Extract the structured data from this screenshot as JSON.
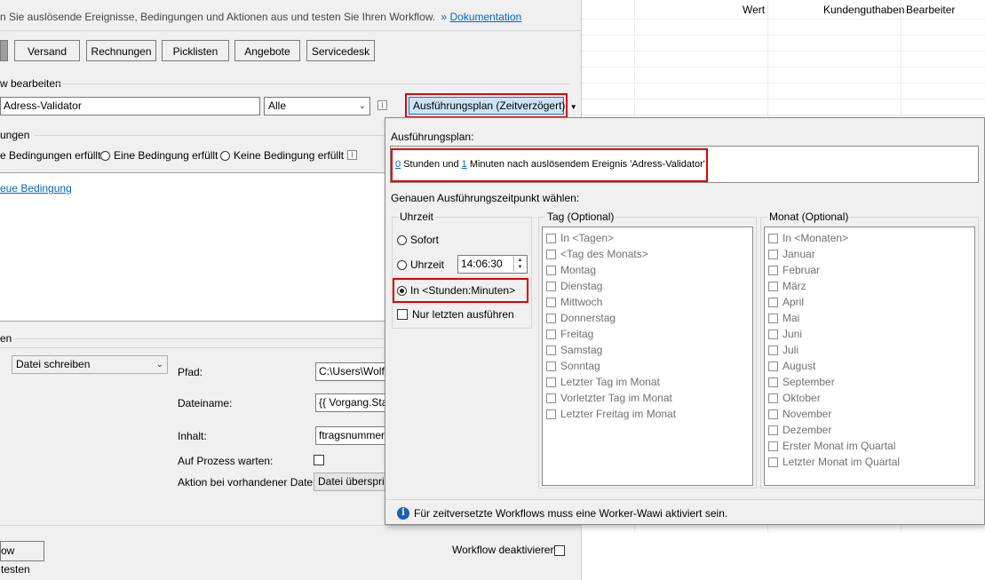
{
  "header": {
    "intro_text": "n Sie auslösende Ereignisse, Bedingungen und Aktionen aus und testen Sie Ihren Workflow.",
    "doc_prefix": "»",
    "doc_link": "Dokumentation"
  },
  "tabs": [
    "Versand",
    "Rechnungen",
    "Picklisten",
    "Angebote",
    "Servicedesk"
  ],
  "workflow": {
    "section_label": "w bearbeiten",
    "name_value": "Adress-Validator",
    "scope_value": "Alle",
    "schedule_button": "Ausführungsplan (Zeitverzögert)"
  },
  "conditions": {
    "section_label": "ungen",
    "radio_all": "e Bedingungen erfüllt",
    "radio_one": "Eine Bedingung erfüllt",
    "radio_none": "Keine Bedingung erfüllt",
    "new_link": "eue Bedingung"
  },
  "actions": {
    "section_label": "en",
    "action_value": "Datei schreiben",
    "path_label": "Pfad:",
    "path_value": "C:\\Users\\Wolf\\",
    "filename_label": "Dateiname:",
    "filename_value": "{{ Vorgang.Star",
    "content_label": "Inhalt:",
    "content_value": "ftragsnummer }}",
    "wait_label": "Auf Prozess warten:",
    "existing_label": "Aktion bei vorhandener Datei:",
    "existing_value": "Datei überspring"
  },
  "footer": {
    "test_button": "ow testen",
    "deactivate_label": "Workflow deaktivieren"
  },
  "grid": {
    "columns": [
      "Wert",
      "Kundenguthaben",
      "Bearbeiter"
    ]
  },
  "popup": {
    "plan_label": "Ausführungsplan:",
    "plan_hours": "0",
    "plan_mid": "Stunden und",
    "plan_minutes": "1",
    "plan_rest": "Minuten nach auslösendem Ereignis 'Adress-Validator'",
    "choose_label": "Genauen Ausführungszeitpunkt wählen:",
    "time_group": "Uhrzeit",
    "opt_sofort": "Sofort",
    "opt_uhrzeit": "Uhrzeit",
    "time_value": "14:06:30",
    "opt_in": "In <Stunden:Minuten>",
    "only_last": "Nur letzten ausführen",
    "day_group": "Tag (Optional)",
    "day_items": [
      "In <Tagen>",
      "<Tag des Monats>",
      "Montag",
      "Dienstag",
      "Mittwoch",
      "Donnerstag",
      "Freitag",
      "Samstag",
      "Sonntag",
      "Letzter Tag im Monat",
      "Vorletzter Tag im Monat",
      "Letzter Freitag im Monat"
    ],
    "month_group": "Monat (Optional)",
    "month_items": [
      "In <Monaten>",
      "Januar",
      "Februar",
      "März",
      "April",
      "Mai",
      "Juni",
      "Juli",
      "August",
      "September",
      "Oktober",
      "November",
      "Dezember",
      "Erster Monat im Quartal",
      "Letzter Monat im Quartal"
    ],
    "footer_note": "Für zeitversetzte Workflows muss eine Worker-Wawi aktiviert sein."
  }
}
